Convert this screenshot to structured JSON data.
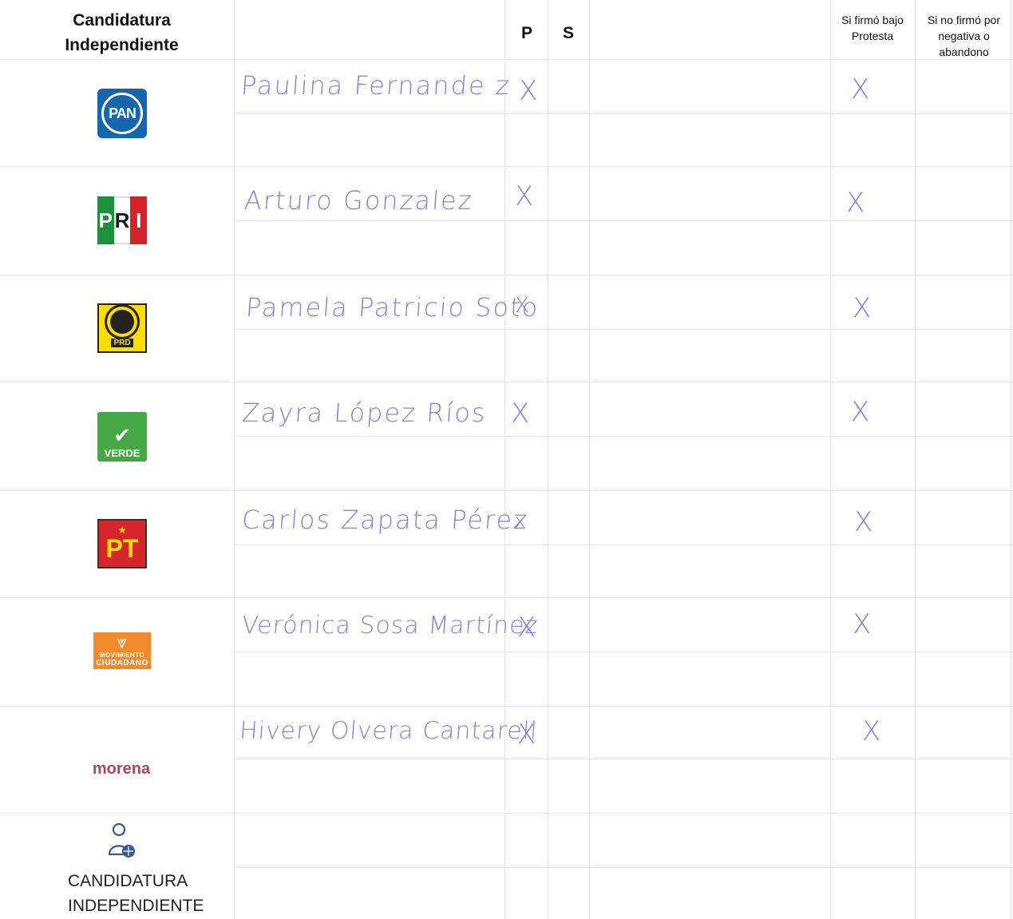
{
  "header": {
    "column_title": "Candidatura Independiente",
    "p_label": "P",
    "s_label": "S",
    "signed_label": "Si firmó bajo Protesta",
    "not_signed_label": "Si no firmó por negativa o abandono"
  },
  "rows": [
    {
      "party": "PAN",
      "logo_text": "PAN",
      "name": "Paulina Fernande z",
      "p_mark": "X",
      "signed_mark": "X"
    },
    {
      "party": "PRI",
      "logo_text": "PRI",
      "name": "Arturo Gonzalez",
      "p_mark": "X",
      "signed_mark": "X"
    },
    {
      "party": "PRD",
      "logo_text": "PRD",
      "name": "Pamela Patricio Soto",
      "p_mark": "X",
      "signed_mark": "X"
    },
    {
      "party": "VERDE",
      "logo_text": "VERDE",
      "name": "Zayra López Ríos",
      "p_mark": "X",
      "signed_mark": "X"
    },
    {
      "party": "PT",
      "logo_text": "PT",
      "name": "Carlos Zapata Pérez",
      "p_mark": "x",
      "signed_mark": "X"
    },
    {
      "party": "MOVIMIENTO CIUDADANO",
      "logo_text_1": "MOVIMIENTO",
      "logo_text_2": "CIUDADANO",
      "name": "Verónica Sosa Martínez",
      "p_mark": "X",
      "signed_mark": "X"
    },
    {
      "party": "morena",
      "logo_text": "morena",
      "name": "Hivery Olvera Cantarell",
      "p_mark": "X",
      "signed_mark": "X"
    }
  ],
  "independent": {
    "label": "CANDIDATURA INDEPENDIENTE"
  },
  "colors": {
    "handwriting": "#8c7fe0",
    "pan_blue": "#1566ad",
    "pri_green": "#1d8f3d",
    "pri_red": "#d2232a",
    "prd_yellow": "#ffdd00",
    "verde_green": "#46a844",
    "pt_red": "#d7262b",
    "mc_orange": "#f08a2c",
    "morena": "#b0465a"
  }
}
